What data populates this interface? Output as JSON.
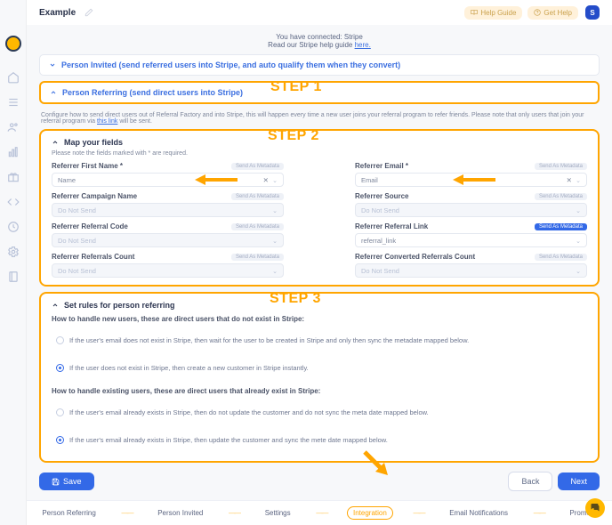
{
  "topbar": {
    "title": "Example",
    "help_guide": "Help Guide",
    "get_help": "Get Help",
    "avatar_initial": "S"
  },
  "banner": {
    "line1": "You have connected: Stripe",
    "line2": "Read our Stripe help guide ",
    "link": "here."
  },
  "accordion": {
    "invited": "Person Invited (send referred users into Stripe, and auto qualify them when they convert)",
    "referring": "Person Referring (send direct users into Stripe)"
  },
  "overlays": {
    "step1": "STEP 1",
    "step2": "STEP 2",
    "step3": "STEP 3"
  },
  "desc": {
    "text": "Configure how to send direct users out of Referral Factory and into Stripe, this will happen every time a new user joins your referral program to refer friends. Please note that only users that join your referral program via ",
    "link": "this link",
    "text2": " will be sent."
  },
  "map": {
    "header": "Map your fields",
    "note": "Please note the fields marked with * are required.",
    "badge_send": "Send As Metadata",
    "fields": [
      {
        "label": "Referrer First Name *",
        "value": "Name",
        "badge": "Send As Metadata",
        "enabled": true,
        "x": true
      },
      {
        "label": "Referrer Email *",
        "value": "Email",
        "badge": "Send As Metadata",
        "enabled": true,
        "x": true
      },
      {
        "label": "Referrer Campaign Name",
        "value": "Do Not Send",
        "badge": "Send As Metadata",
        "enabled": false
      },
      {
        "label": "Referrer Source",
        "value": "Do Not Send",
        "badge": "Send As Metadata",
        "enabled": false
      },
      {
        "label": "Referrer Referral Code",
        "value": "Do Not Send",
        "badge": "Send As Metadata",
        "enabled": false
      },
      {
        "label": "Referrer Referral Link",
        "value": "referral_link",
        "badge": "Send As Metadata",
        "enabled": true,
        "blue": true
      },
      {
        "label": "Referrer Referrals Count",
        "value": "Do Not Send",
        "badge": "Send As Metadata",
        "enabled": false
      },
      {
        "label": "Referrer Converted Referrals Count",
        "value": "Do Not Send",
        "badge": "Send As Metadata",
        "enabled": false
      }
    ]
  },
  "rules": {
    "header": "Set rules for person referring",
    "new_title": "How to handle new users, these are direct users that do not exist in Stripe:",
    "new_opts": [
      "If the user's email does not exist in Stripe, then wait for the user to be created in Stripe and only then sync the metadate mapped below.",
      "If the user does not exist in Stripe, then create a new customer in Stripe instantly."
    ],
    "new_selected": 1,
    "existing_title": "How to handle existing users, these are direct users that already exist in Stripe:",
    "existing_opts": [
      "If the user's email already exists in Stripe, then do not update the customer and do not sync the meta date mapped below.",
      "If the user's email already exists in Stripe, then update the customer and sync the mete date mapped below."
    ],
    "existing_selected": 1
  },
  "footer": {
    "save": "Save",
    "back": "Back",
    "next": "Next"
  },
  "stepper": {
    "items": [
      "Person Referring",
      "Person Invited",
      "Settings",
      "Integration",
      "Email Notifications",
      "Promote"
    ],
    "active": 3
  }
}
